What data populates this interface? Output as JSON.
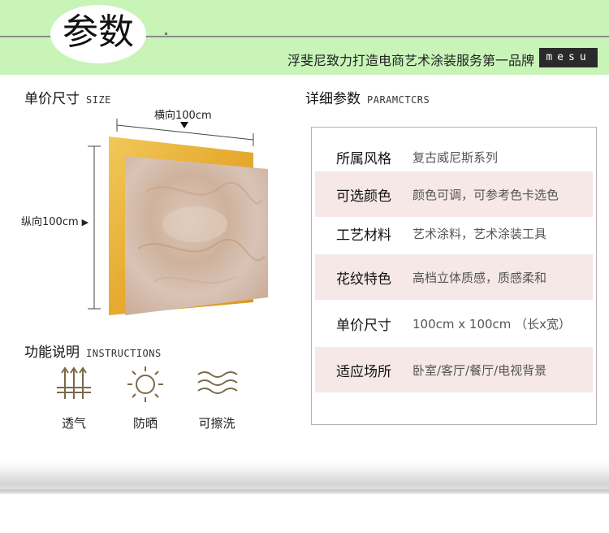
{
  "header": {
    "title": "参数",
    "slogan": "浮斐尼致力打造电商艺术涂装服务第一品牌",
    "brand": "mesu",
    "background_color": "#c8f4b8"
  },
  "size_section": {
    "title": "单价尺寸",
    "subtitle": "SIZE",
    "horizontal_label": "横向100cm",
    "vertical_label": "纵向100cm"
  },
  "function_section": {
    "title": "功能说明",
    "subtitle": "INSTRUCTIONS",
    "items": [
      {
        "icon": "breathable-icon",
        "label": "透气"
      },
      {
        "icon": "sun-icon",
        "label": "防晒"
      },
      {
        "icon": "wave-icon",
        "label": "可擦洗"
      }
    ]
  },
  "params_section": {
    "title": "详细参数",
    "subtitle": "PARAMCTCRS",
    "rows": [
      {
        "key": "所属风格",
        "value": "复古威尼斯系列"
      },
      {
        "key": "可选颜色",
        "value": "颜色可调，可参考色卡选色"
      },
      {
        "key": "工艺材料",
        "value": "艺术涂料，艺术涂装工具"
      },
      {
        "key": "花纹特色",
        "value": "高档立体质感，质感柔和"
      },
      {
        "key": "单价尺寸",
        "value": "100cm x 100cm （长x宽）"
      },
      {
        "key": "适应场所",
        "value": "卧室/客厅/餐厅/电视背景"
      }
    ],
    "row_highlight_color": "#f5e8e6"
  },
  "colors": {
    "gold_panel": "#e8b43a",
    "marble_panel": "#d6c0b4",
    "icon_stroke": "#7a6a4a"
  }
}
